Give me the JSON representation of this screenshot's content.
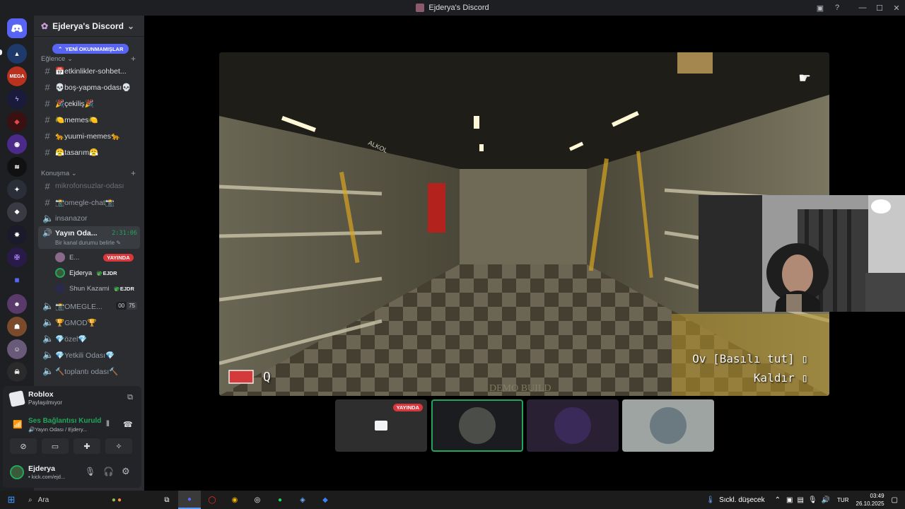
{
  "window": {
    "title": "Ejderya's Discord"
  },
  "server": {
    "name": "Ejderya's Discord",
    "unread_pill": "YENİ OKUNMAMIŞLAR"
  },
  "categories": {
    "fun": "Eğlence",
    "talk": "Konuşma"
  },
  "text_channels": [
    {
      "name": "📅etkinlikler-sohbet..."
    },
    {
      "name": "💀boş-yapma-odası💀"
    },
    {
      "name": "🎉çekiliş🎉"
    },
    {
      "name": "🍋memes🍋"
    },
    {
      "name": "🐆yuumi-memes🐆"
    },
    {
      "name": "😤tasarım😤"
    }
  ],
  "talk_channels": [
    {
      "name": "mikrofonsuzlar-odası"
    },
    {
      "name": "📸omegle-chat📸"
    },
    {
      "name": "insanazor"
    }
  ],
  "active_voice": {
    "name": "Yayın Oda...",
    "timer": "2:31:06",
    "status": "Bir kanal durumu belirle",
    "users": [
      {
        "name": "E...",
        "badge": "YAYINDA"
      },
      {
        "name": "Ejderya",
        "tag": "EJDR"
      },
      {
        "name": "Shun Kazami",
        "tag": "EJDR"
      }
    ]
  },
  "voice_channels": [
    {
      "name": "📸OMEGLE...",
      "count_a": "00",
      "count_b": "75"
    },
    {
      "name": "🏆GMOD🏆"
    },
    {
      "name": "💎özel💎"
    },
    {
      "name": "💎Yetkili Odası💎"
    },
    {
      "name": "🔨toplantı odası🔨"
    }
  ],
  "activity": {
    "title": "Roblox",
    "subtitle": "Paylaşılmıyor"
  },
  "voice_status": {
    "title": "Ses Bağlantısı Kuruld",
    "subtitle": "🔊Yayın Odası / Ejdery..."
  },
  "user": {
    "name": "Ejderya",
    "status": "kick.com/ejd..."
  },
  "stream": {
    "hud_key": "Q",
    "hud_hold": "Ov [Basılı tut]",
    "hud_lift": "Kaldır",
    "watermark": "DEMO BUILD",
    "sign_left": "ALKOL"
  },
  "tiles": [
    {
      "badge": "YAYINDA"
    }
  ],
  "taskbar": {
    "search": "Ara",
    "weather": "Sıckl. düşecek",
    "lang": "TUR",
    "time": "03:49",
    "date": "26.10.2025"
  },
  "colors": {
    "accent_green": "#23a55a",
    "live_red": "#da373c",
    "blurple": "#5865f2"
  }
}
